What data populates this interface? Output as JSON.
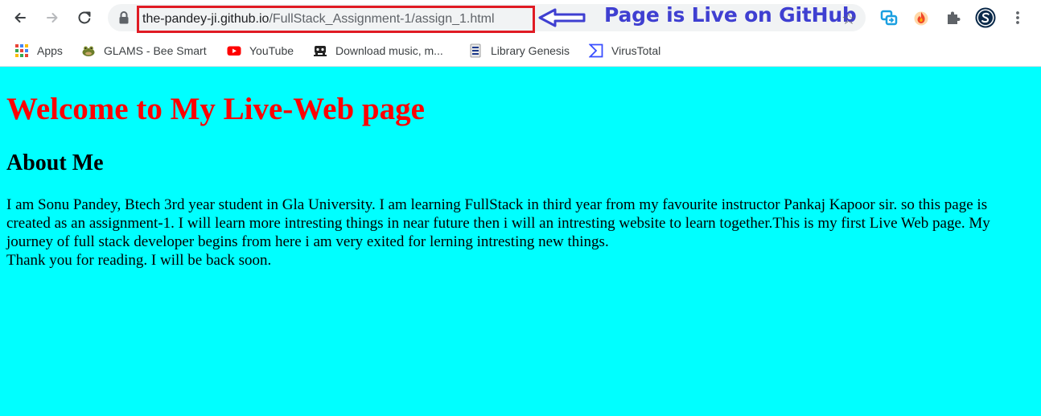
{
  "browser": {
    "url_domain": "the-pandey-ji.github.io",
    "url_path": "/FullStack_Assignment-1/assign_1.html",
    "annotation_text": "Page is Live on GitHub",
    "colors": {
      "annotation": "#3f3fd1",
      "highlight_box": "#e01b24"
    }
  },
  "bookmarks": [
    {
      "label": "Apps",
      "icon": "apps-grid-icon"
    },
    {
      "label": "GLAMS - Bee Smart",
      "icon": "frog-icon"
    },
    {
      "label": "YouTube",
      "icon": "youtube-icon"
    },
    {
      "label": "Download music, m...",
      "icon": "music-download-icon"
    },
    {
      "label": "Library Genesis",
      "icon": "library-icon"
    },
    {
      "label": "VirusTotal",
      "icon": "virustotal-icon"
    }
  ],
  "page": {
    "heading": "Welcome to My Live-Web page",
    "subheading": "About Me",
    "paragraph_line_1": "I am Sonu Pandey, Btech 3rd year student in Gla University. I am learning FullStack in third year from my favourite instructor Pankaj Kapoor sir. so this page is created as an assignment-1. I will learn more intresting things in near future then i will an intresting website to learn together.This is my first Live Web page. My journey of full stack developer begins from here i am very exited for lerning intresting new things.",
    "paragraph_line_2": "Thank you for reading. I will be back soon.",
    "colors": {
      "background": "#00ffff",
      "heading": "#ff0000"
    }
  }
}
